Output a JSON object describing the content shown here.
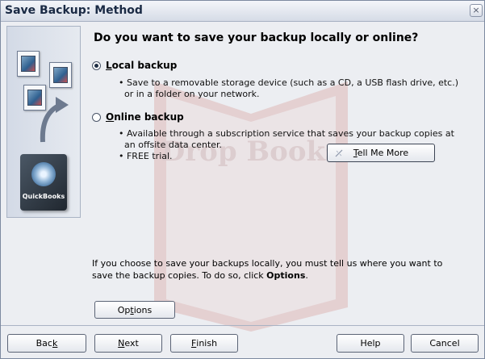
{
  "window": {
    "title": "Save Backup: Method",
    "close_glyph": "×"
  },
  "side_panel": {
    "logo_text": "QuickBooks"
  },
  "question": "Do you want to save your backup locally or online?",
  "options": {
    "local": {
      "accel": "L",
      "rest": "ocal backup",
      "selected": true,
      "bullets": [
        "• Save to a removable storage device (such as a CD, a USB flash drive, etc.)",
        "or in a folder on your network."
      ]
    },
    "online": {
      "accel": "O",
      "rest": "nline backup",
      "selected": false,
      "bullets": [
        "• Available through a subscription service that saves your backup copies at",
        "an offsite data center.",
        "• FREE trial."
      ]
    }
  },
  "tell_me_more": {
    "accel": "T",
    "rest": "ell Me More"
  },
  "info": {
    "line1": "If you choose to save your backups locally, you must tell us where you want to",
    "line2_pre": "save the backup copies. To do so, click ",
    "line2_bold": "Options",
    "line2_post": "."
  },
  "options_button": {
    "pre": "Op",
    "accel": "t",
    "rest": "ions"
  },
  "footer": {
    "back": {
      "pre": "Bac",
      "accel": "k",
      "rest": ""
    },
    "next": {
      "pre": "",
      "accel": "N",
      "rest": "ext"
    },
    "finish": {
      "pre": "",
      "accel": "F",
      "rest": "inish"
    },
    "help": {
      "pre": "",
      "accel": "",
      "rest": "Help"
    },
    "cancel": {
      "pre": "",
      "accel": "",
      "rest": "Cancel"
    }
  },
  "watermark_text": "Drop Books",
  "colors": {
    "title_text": "#1a2a44",
    "panel": "#d3dae6",
    "watermark": "#c0392b"
  }
}
